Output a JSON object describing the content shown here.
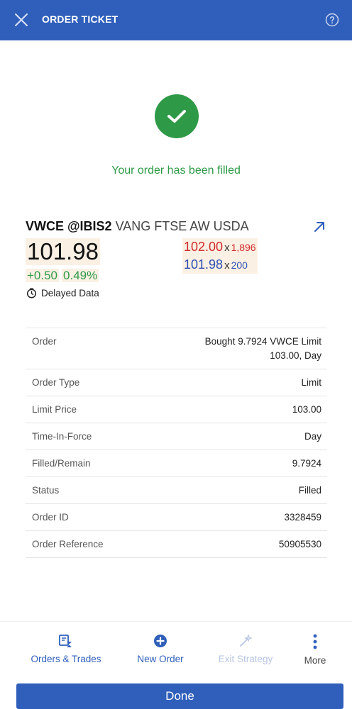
{
  "header": {
    "title": "ORDER TICKET",
    "close_icon": "close-icon",
    "help_icon": "help-icon"
  },
  "status": {
    "message": "Your order has been filled",
    "icon": "checkmark-icon",
    "color": "#2e9a47"
  },
  "instrument": {
    "ticker": "VWCE @IBIS2",
    "description": "VANG FTSE AW USDA",
    "last_price": "101.98",
    "change": "+0.50",
    "change_pct": "0.49%",
    "ask_price": "102.00",
    "ask_size": "1,896",
    "bid_price": "101.98",
    "bid_size": "200",
    "x_sep": "x",
    "delayed_label": "Delayed Data"
  },
  "details": [
    {
      "label": "Order",
      "value": "Bought 9.7924 VWCE Limit 103.00, Day"
    },
    {
      "label": "Order Type",
      "value": "Limit"
    },
    {
      "label": "Limit Price",
      "value": "103.00"
    },
    {
      "label": "Time-In-Force",
      "value": "Day"
    },
    {
      "label": "Filled/Remain",
      "value": "9.7924"
    },
    {
      "label": "Status",
      "value": "Filled"
    },
    {
      "label": "Order ID",
      "value": "3328459"
    },
    {
      "label": "Order Reference",
      "value": "50905530"
    }
  ],
  "bottom_nav": {
    "orders_trades": "Orders & Trades",
    "new_order": "New Order",
    "exit_strategy": "Exit Strategy",
    "more": "More"
  },
  "done_label": "Done",
  "colors": {
    "brand": "#2f5fbb",
    "positive": "#2e9a47",
    "ask": "#d12a2a",
    "bid": "#2f4fb0",
    "highlight": "#fbf0e4"
  }
}
